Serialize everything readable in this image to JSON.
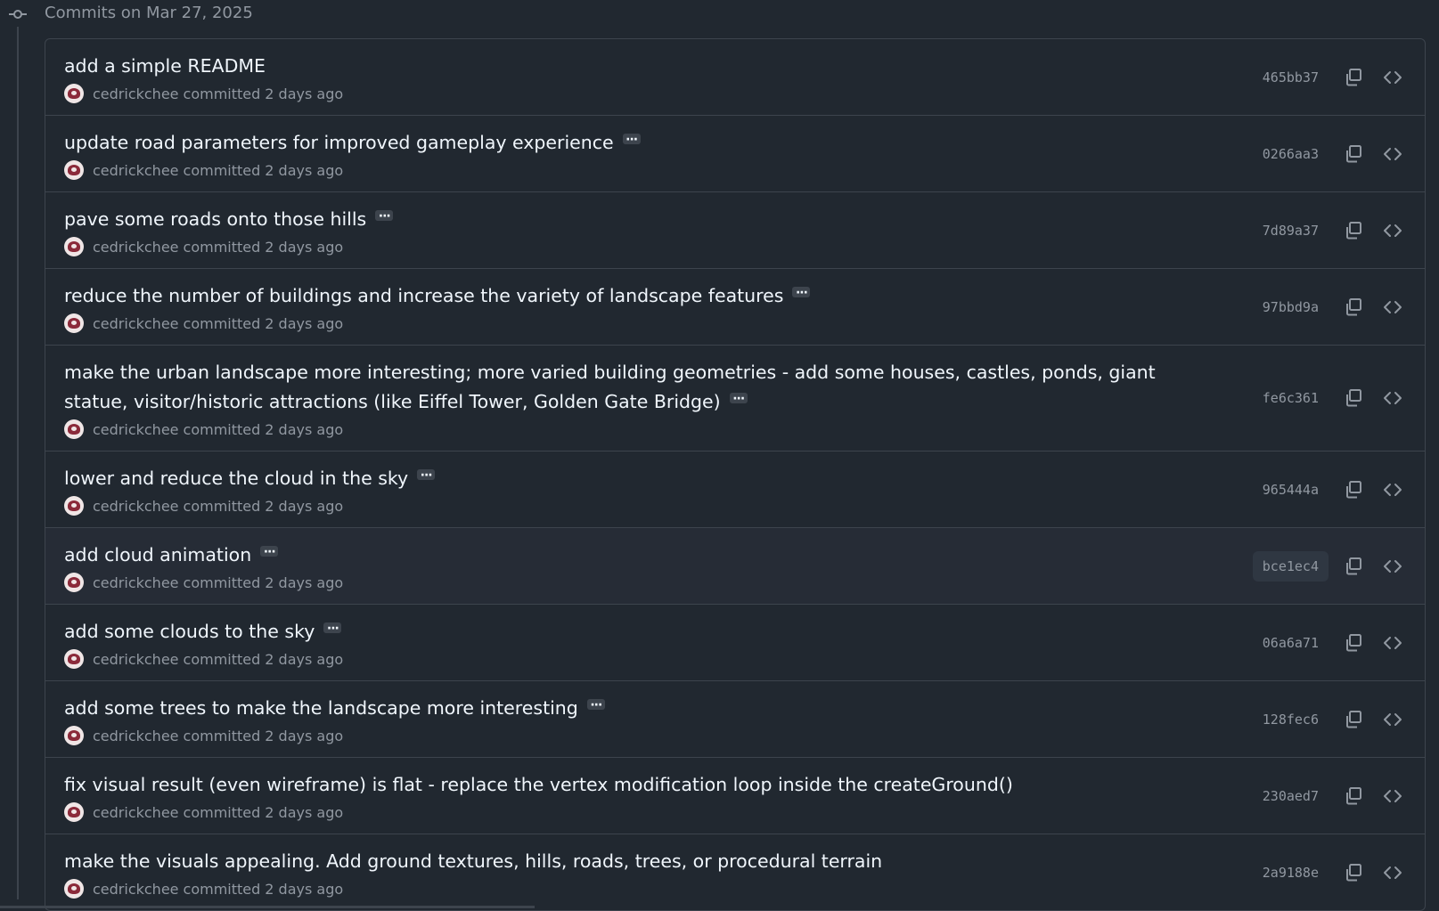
{
  "date_header": {
    "label": "Commits on Mar 27, 2025"
  },
  "commits": [
    {
      "title": "add a simple README",
      "has_more": false,
      "author": "cedrickchee",
      "action": "committed",
      "time": "2 days ago",
      "sha": "465bb37"
    },
    {
      "title": "update road parameters for improved gameplay experience",
      "has_more": true,
      "author": "cedrickchee",
      "action": "committed",
      "time": "2 days ago",
      "sha": "0266aa3"
    },
    {
      "title": "pave some roads onto those hills",
      "has_more": true,
      "author": "cedrickchee",
      "action": "committed",
      "time": "2 days ago",
      "sha": "7d89a37"
    },
    {
      "title": "reduce the number of buildings and increase the variety of landscape features",
      "has_more": true,
      "author": "cedrickchee",
      "action": "committed",
      "time": "2 days ago",
      "sha": "97bbd9a"
    },
    {
      "title": "make the urban landscape more interesting; more varied building geometries - add some houses, castles, ponds, giant statue, visitor/historic attractions (like Eiffel Tower, Golden Gate Bridge)",
      "has_more": true,
      "author": "cedrickchee",
      "action": "committed",
      "time": "2 days ago",
      "sha": "fe6c361"
    },
    {
      "title": "lower and reduce the cloud in the sky",
      "has_more": true,
      "author": "cedrickchee",
      "action": "committed",
      "time": "2 days ago",
      "sha": "965444a"
    },
    {
      "title": "add cloud animation",
      "has_more": true,
      "author": "cedrickchee",
      "action": "committed",
      "time": "2 days ago",
      "sha": "bce1ec4",
      "hovered": true
    },
    {
      "title": "add some clouds to the sky",
      "has_more": true,
      "author": "cedrickchee",
      "action": "committed",
      "time": "2 days ago",
      "sha": "06a6a71"
    },
    {
      "title": "add some trees to make the landscape more interesting",
      "has_more": true,
      "author": "cedrickchee",
      "action": "committed",
      "time": "2 days ago",
      "sha": "128fec6"
    },
    {
      "title": "fix visual result (even wireframe) is flat - replace the vertex modification loop inside the createGround()",
      "has_more": false,
      "author": "cedrickchee",
      "action": "committed",
      "time": "2 days ago",
      "sha": "230aed7"
    },
    {
      "title": "make the visuals appealing. Add ground textures, hills, roads, trees, or procedural terrain",
      "has_more": false,
      "author": "cedrickchee",
      "action": "committed",
      "time": "2 days ago",
      "sha": "2a9188e"
    }
  ],
  "icons": {
    "timeline": "git-commit-icon",
    "copy": "copy-icon",
    "browse": "code-icon",
    "more": "ellipsis-icon",
    "avatar": "avatar"
  },
  "colors": {
    "background": "#212830",
    "border": "#3d444d",
    "text": "#f0f6fc",
    "muted": "#9198a1"
  }
}
